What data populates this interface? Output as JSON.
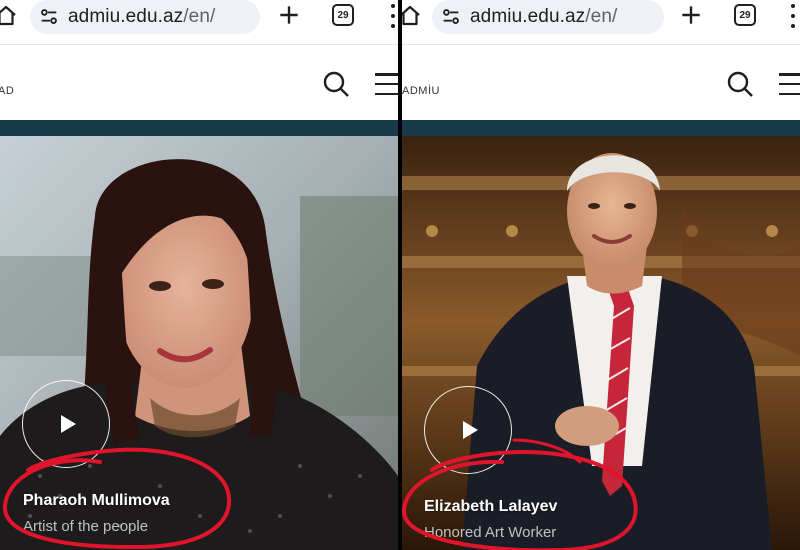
{
  "left_panel": {
    "browser": {
      "url_host": "admiu.edu.az",
      "url_path": "/en/",
      "tab_count": "29"
    },
    "site": {
      "logo_text": "AD"
    },
    "slide": {
      "name": "Pharaoh Mullimova",
      "title": "Artist of the people"
    }
  },
  "right_panel": {
    "browser": {
      "url_host": "admiu.edu.az",
      "url_path": "/en/",
      "tab_count": "29"
    },
    "site": {
      "logo_text": "ADMİU"
    },
    "slide": {
      "name": "Elizabeth Lalayev",
      "title": "Honored Art Worker"
    }
  },
  "colors": {
    "header_bar": "#163a4a",
    "annotation": "#e0142b",
    "url_bg": "#eef1f6"
  },
  "icons": [
    "home-icon",
    "tune-icon",
    "plus-icon",
    "tabs-counter-icon",
    "more-vert-icon",
    "search-icon",
    "hamburger-menu-icon",
    "play-icon"
  ]
}
